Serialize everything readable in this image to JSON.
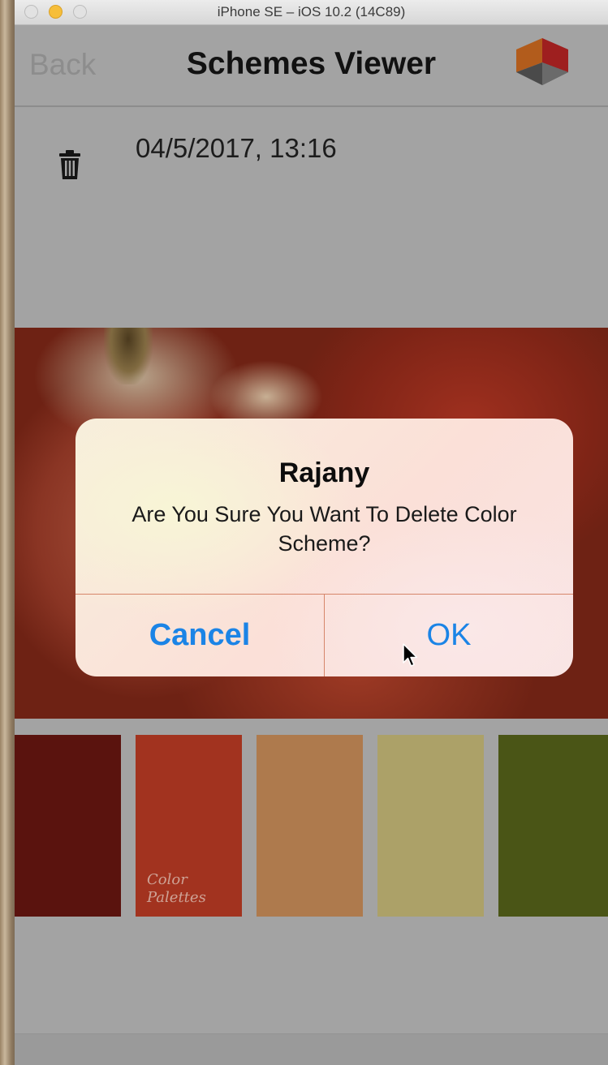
{
  "window": {
    "title": "iPhone SE – iOS 10.2 (14C89)"
  },
  "navbar": {
    "back_label": "Back",
    "title": "Schemes Viewer",
    "logo_icon": "cube-logo-icon"
  },
  "scheme": {
    "date": "04/5/2017, 13:16",
    "delete_icon": "trash-icon"
  },
  "palette": {
    "swatches": [
      "#5a130e",
      "#a2331f",
      "#ae7a4d",
      "#aca168",
      "#4a5516"
    ],
    "watermark_line1": "Color",
    "watermark_line2": "Palettes"
  },
  "alert": {
    "title": "Rajany",
    "message": "Are You Sure You Want To Delete Color Scheme?",
    "cancel_label": "Cancel",
    "ok_label": "OK",
    "button_color": "#1b84e6"
  }
}
